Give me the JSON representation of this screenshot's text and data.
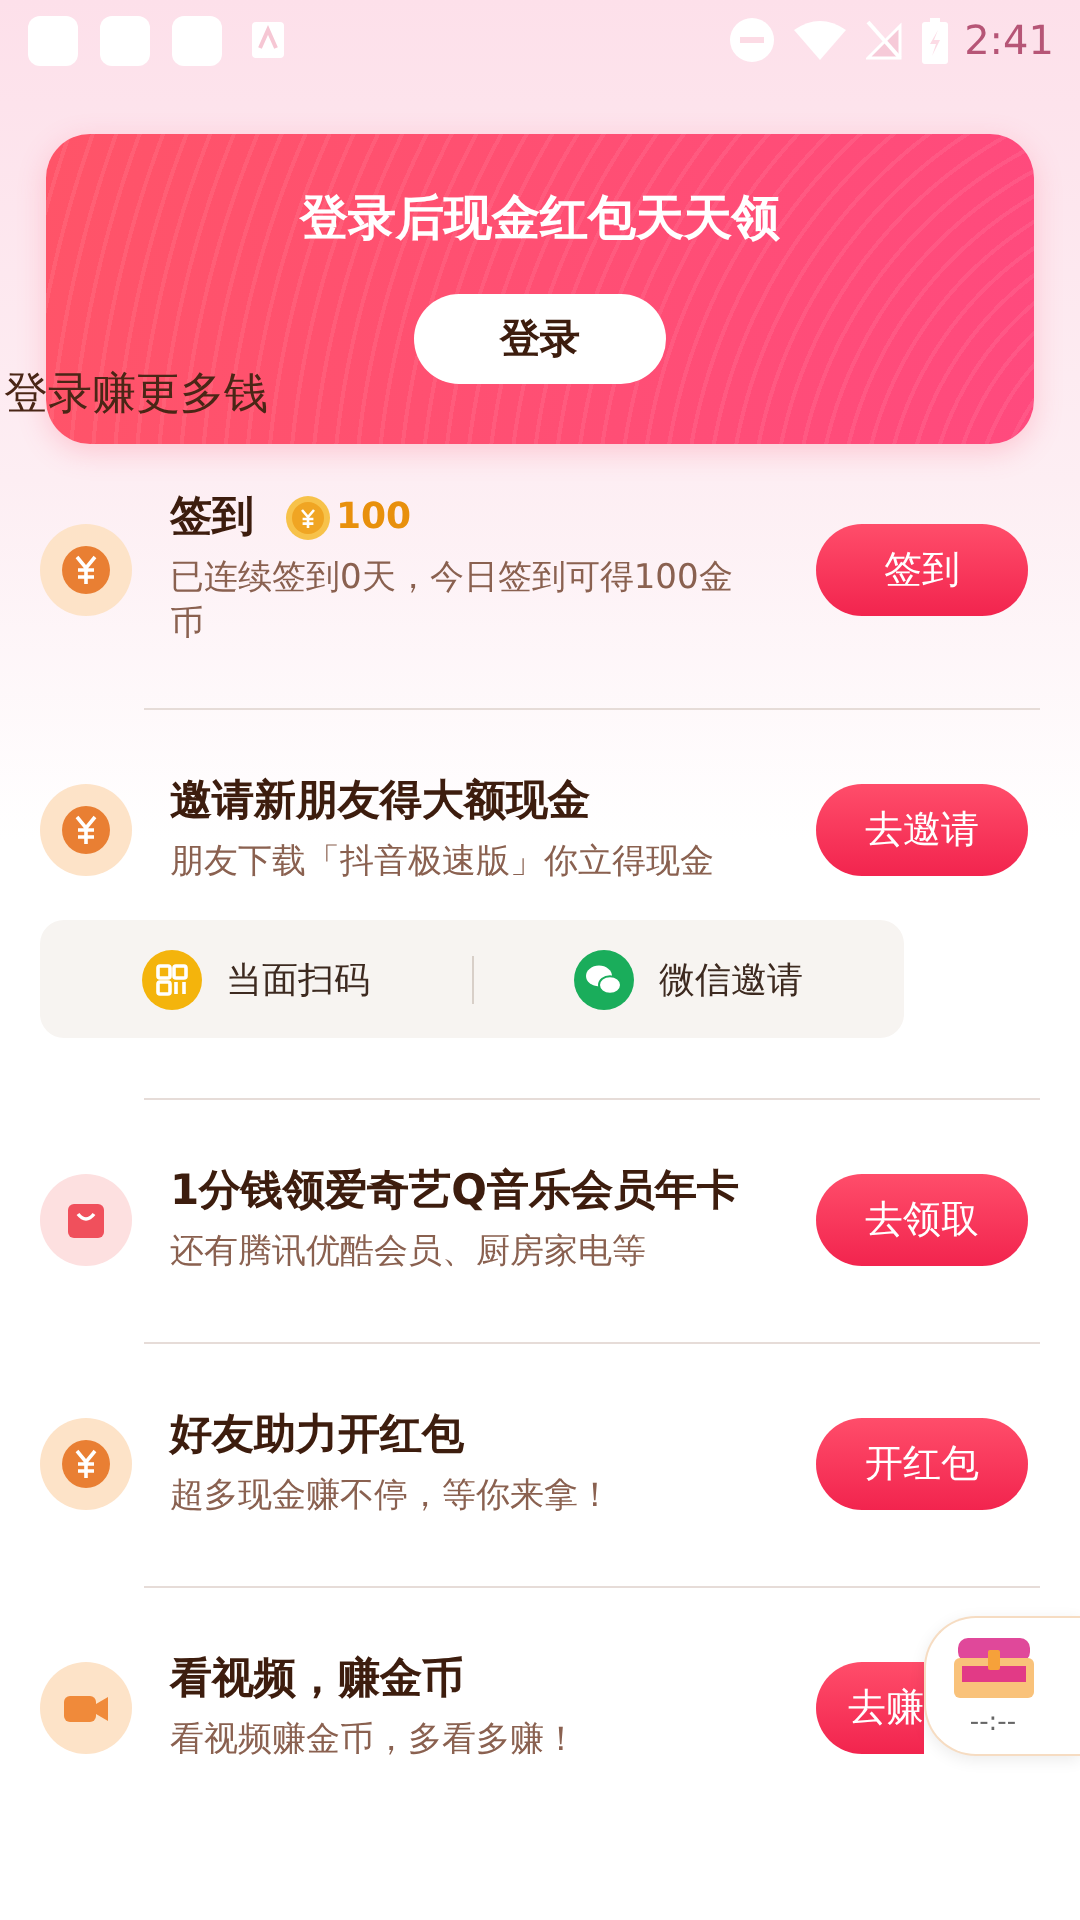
{
  "status_bar": {
    "time": "2:41"
  },
  "banner": {
    "title": "登录后现金红包天天领",
    "button": "登录"
  },
  "overlay_text": "登录赚更多钱",
  "tasks": [
    {
      "kind": "coin",
      "title": "签到",
      "reward": "100",
      "subtitle": "已连续签到0天，今日签到可得100金币",
      "button": "签到"
    },
    {
      "kind": "coin",
      "title": "邀请新朋友得大额现金",
      "subtitle": "朋友下载「抖音极速版」你立得现金",
      "button": "去邀请",
      "share_options": [
        {
          "kind": "qr",
          "label": "当面扫码"
        },
        {
          "kind": "wechat",
          "label": "微信邀请"
        }
      ]
    },
    {
      "kind": "bag",
      "title": "1分钱领爱奇艺Q音乐会员年卡",
      "subtitle": "还有腾讯优酷会员、厨房家电等",
      "button": "去领取"
    },
    {
      "kind": "coin",
      "title": "好友助力开红包",
      "subtitle": "超多现金赚不停，等你来拿！",
      "button": "开红包"
    },
    {
      "kind": "video",
      "title": "看视频，赚金币",
      "subtitle": "看视频赚金币，多看多赚！",
      "button": "去赚"
    }
  ],
  "float_timer": {
    "time": "--:--"
  }
}
